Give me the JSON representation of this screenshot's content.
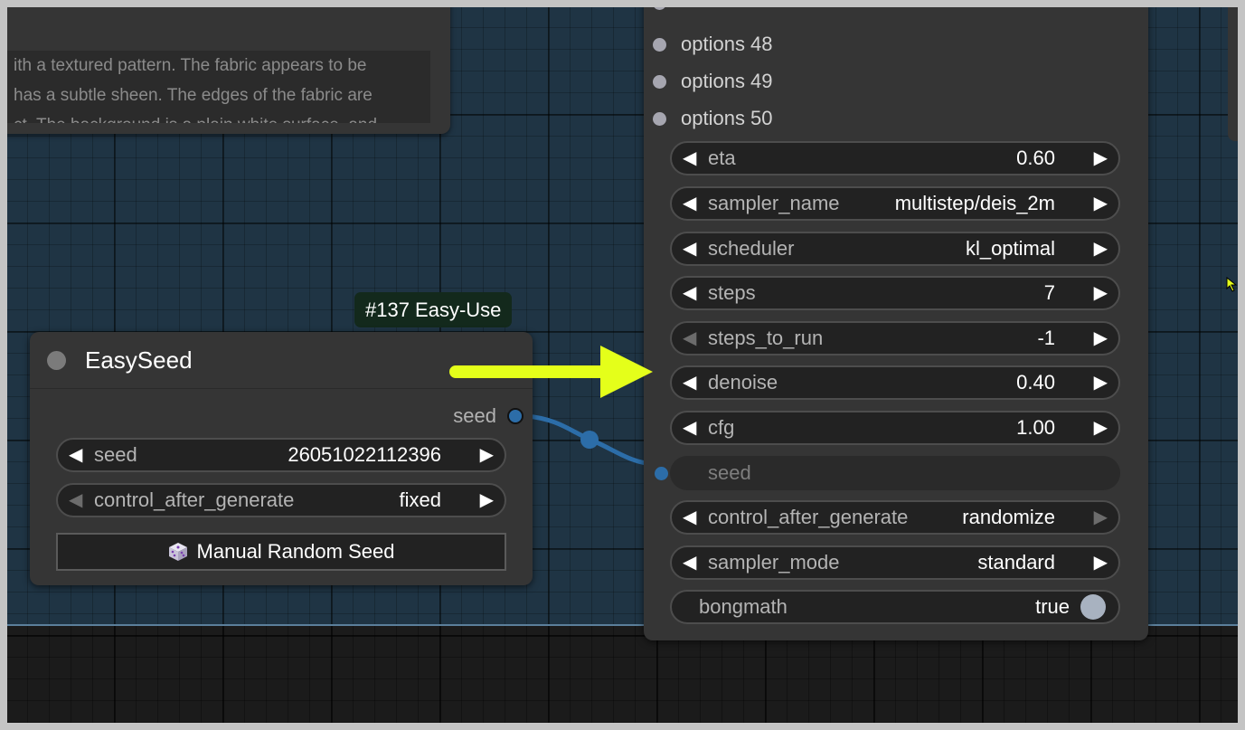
{
  "text_node": {
    "lines": [
      "ith a textured pattern. The fabric appears to be",
      "has a subtle sheen. The edges of the fabric are",
      "ct. The background is a plain white surface, and"
    ]
  },
  "badge": {
    "label": "#137 Easy-Use"
  },
  "easyseed": {
    "title": "EasySeed",
    "output_label": "seed",
    "widgets": [
      {
        "label": "seed",
        "value": "26051022112396"
      },
      {
        "label": "control_after_generate",
        "value": "fixed"
      }
    ],
    "button_label": "Manual Random Seed"
  },
  "sampler": {
    "options": [
      {
        "label": "options 48"
      },
      {
        "label": "options 49"
      },
      {
        "label": "options 50"
      }
    ],
    "widgets": [
      {
        "label": "eta",
        "value": "0.60"
      },
      {
        "label": "sampler_name",
        "value": "multistep/deis_2m"
      },
      {
        "label": "scheduler",
        "value": "kl_optimal"
      },
      {
        "label": "steps",
        "value": "7"
      },
      {
        "label": "steps_to_run",
        "value": "-1"
      },
      {
        "label": "denoise",
        "value": "0.40"
      },
      {
        "label": "cfg",
        "value": "1.00"
      }
    ],
    "seed_input_label": "seed",
    "widgets2": [
      {
        "label": "control_after_generate",
        "value": "randomize"
      },
      {
        "label": "sampler_mode",
        "value": "standard"
      }
    ],
    "toggle": {
      "label": "bongmath",
      "value": "true"
    }
  },
  "colors": {
    "canvas": "#1f3444",
    "node_bg": "#353535",
    "widget_bg": "#222222",
    "wire": "#2c6da8",
    "arrow": "#e4ff1a",
    "badge_bg": "#13291c"
  },
  "icons": [
    "dice-icon",
    "arrow-left-icon",
    "arrow-right-icon",
    "cursor-icon"
  ]
}
